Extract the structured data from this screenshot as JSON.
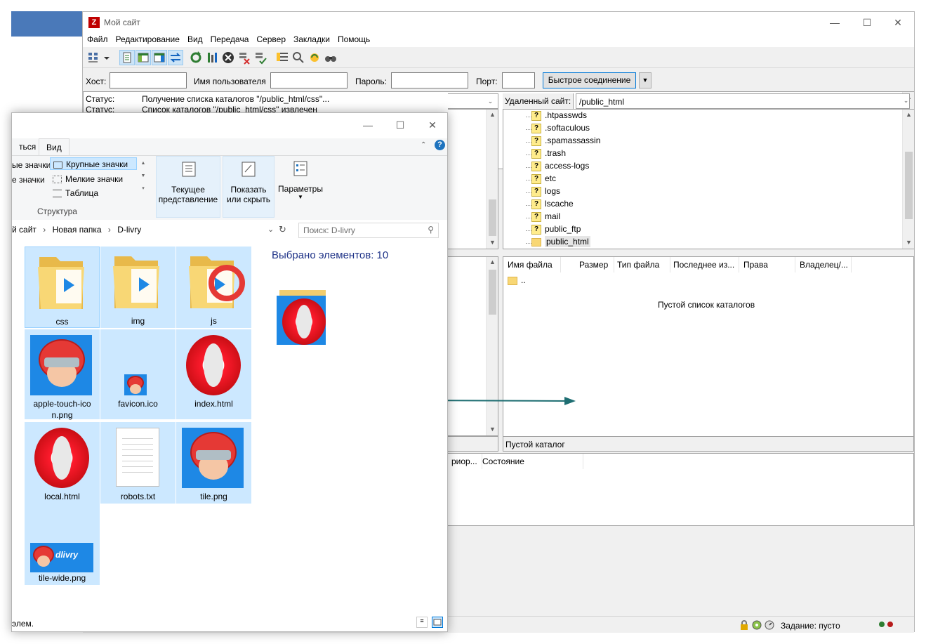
{
  "filezilla": {
    "title": "Мой сайт",
    "logo": "Z",
    "menu": [
      "Файл",
      "Редактирование",
      "Вид",
      "Передача",
      "Сервер",
      "Закладки",
      "Помощь"
    ],
    "quickconnect": {
      "host_label": "Хост:",
      "host_value": "",
      "user_label": "Имя пользователя",
      "user_value": "",
      "pass_label": "Пароль:",
      "pass_value": "",
      "port_label": "Порт:",
      "port_value": "",
      "button": "Быстрое соединение"
    },
    "log": [
      {
        "k": "Статус:",
        "v": "Получение списка каталогов \"/public_html/css\"..."
      },
      {
        "k": "Статус:",
        "v": "Список каталогов \"/public_html/css\" извлечен"
      }
    ],
    "remote_site_label": "Удаленный сайт:",
    "remote_site_value": "/public_html",
    "tree": [
      ".htpasswds",
      ".softaculous",
      ".spamassassin",
      ".trash",
      "access-logs",
      "etc",
      "logs",
      "lscache",
      "mail",
      "public_ftp",
      "public_html"
    ],
    "tree_selected": "public_html",
    "columns": [
      "Имя файла",
      "Размер",
      "Тип файла",
      "Последнее из...",
      "Права",
      "Владелец/..."
    ],
    "parent_dir": "..",
    "empty_list": "Пустой список каталогов",
    "remote_status": "Пустой каталог",
    "queue_columns": [
      "риор...",
      "Состояние"
    ],
    "task_status": "Задание: пусто"
  },
  "explorer": {
    "tabs": [
      "ться",
      "Вид"
    ],
    "layout": {
      "row1_left": "ые значки",
      "row1_right": "Крупные значки",
      "row2_left": "е значки",
      "row2_right": "Мелкие значки",
      "row3_right": "Таблица",
      "group": "Структура"
    },
    "current_view": {
      "line1": "Текущее",
      "line2": "представление"
    },
    "show_hide": {
      "line1": "Показать",
      "line2": "или скрыть"
    },
    "options": "Параметры",
    "breadcrumb": [
      "й сайт",
      "Новая папка",
      "D-livry"
    ],
    "search_placeholder": "Поиск: D-livry",
    "selected_count": "Выбрано элементов: 10",
    "files": [
      {
        "name": "css",
        "type": "folder"
      },
      {
        "name": "img",
        "type": "folder"
      },
      {
        "name": "js",
        "type": "folder"
      },
      {
        "name": "apple-touch-icon.png",
        "label1": "apple-touch-ico",
        "label2": "n.png",
        "type": "png"
      },
      {
        "name": "favicon.ico",
        "type": "ico"
      },
      {
        "name": "index.html",
        "type": "html"
      },
      {
        "name": "local.html",
        "type": "html"
      },
      {
        "name": "robots.txt",
        "type": "txt"
      },
      {
        "name": "tile.png",
        "type": "png"
      },
      {
        "name": "tile-wide.png",
        "type": "wide",
        "brand": "dlivry"
      }
    ],
    "status": "элем."
  },
  "colors": {
    "accent": "#0078d7",
    "selection": "#cce8ff",
    "filezilla_red": "#bf0000",
    "arrow": "#1e6e72"
  }
}
